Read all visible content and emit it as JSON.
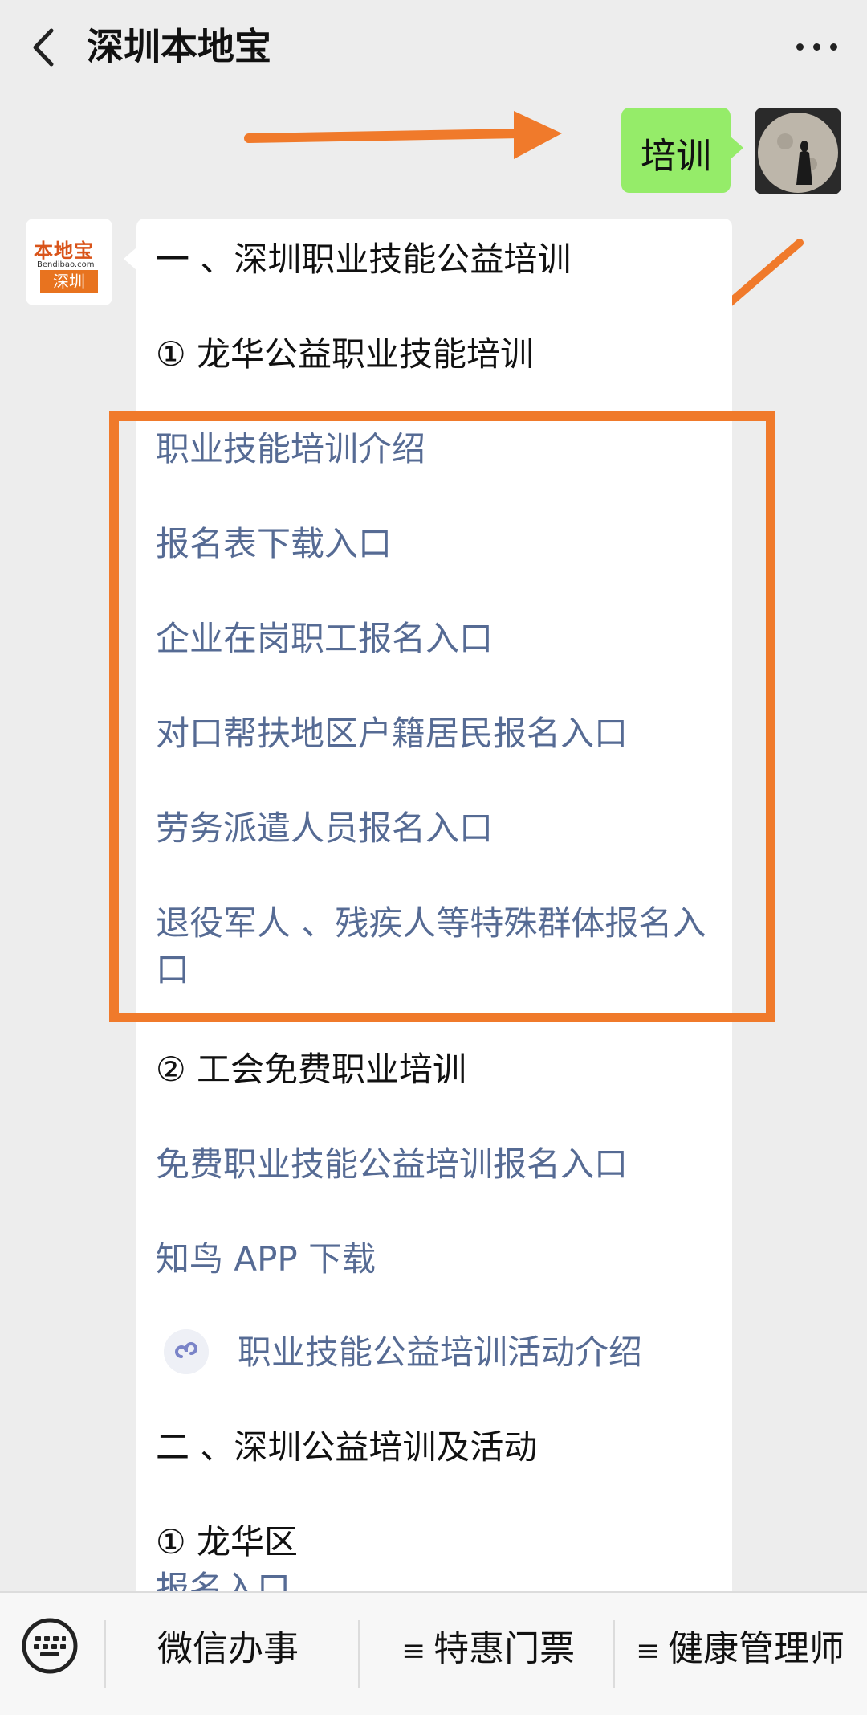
{
  "header": {
    "title": "深圳本地宝"
  },
  "chat": {
    "user_message": "培训",
    "bot_logo": {
      "brand": "本地宝",
      "url": "Bendibao.com",
      "city": "深圳"
    },
    "reply": {
      "section1_title": "一 、深圳职业技能公益培训",
      "sub1_title": "① 龙华公益职业技能培训",
      "links1": [
        "职业技能培训介绍",
        "报名表下载入口",
        "企业在岗职工报名入口",
        "对口帮扶地区户籍居民报名入口",
        "劳务派遣人员报名入口",
        "退役军人 、残疾人等特殊群体报名入口"
      ],
      "sub2_title": "② 工会免费职业培训",
      "links2": [
        "免费职业技能公益培训报名入口",
        "知鸟 APP 下载"
      ],
      "mini_program_link": "职业技能公益培训活动介绍",
      "section2_title": "二 、深圳公益培训及活动",
      "sub3_title": "① 龙华区",
      "cut_line": "报名入口"
    }
  },
  "bottom_menu": {
    "items": [
      "微信办事",
      "特惠门票",
      "健康管理师"
    ]
  },
  "colors": {
    "accent_orange": "#f07a2b",
    "link": "#566b94",
    "user_bubble": "#95ec69"
  }
}
